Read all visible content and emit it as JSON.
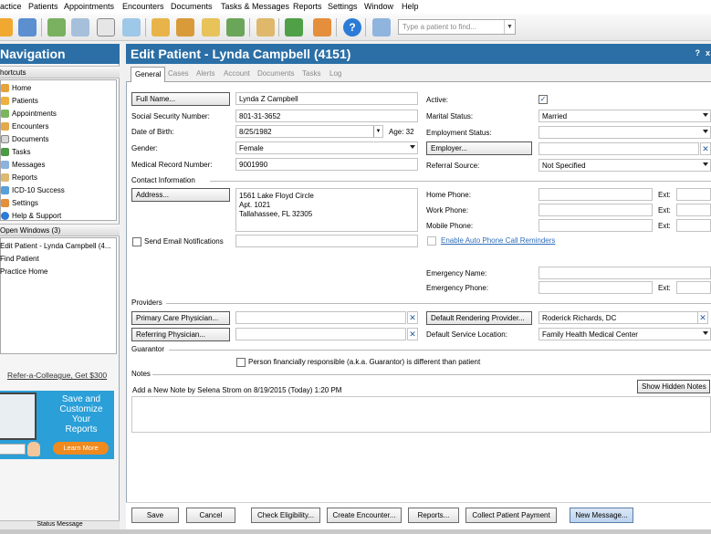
{
  "menu": [
    "actice",
    "Patients",
    "Appointments",
    "Encounters",
    "Documents",
    "Tasks & Messages",
    "Reports",
    "Settings",
    "Window",
    "Help"
  ],
  "toolbar": {
    "find_placeholder": "Type a patient to find..."
  },
  "nav": {
    "title": "Navigation",
    "shortcuts_header": "hortcuts",
    "shortcuts": [
      "Home",
      "Patients",
      "Appointments",
      "Encounters",
      "Documents",
      "Tasks",
      "Messages",
      "Reports",
      "ICD-10 Success",
      "Settings",
      "Help & Support"
    ],
    "open_windows_header": "Open Windows (3)",
    "open_windows": [
      "Edit Patient - Lynda Campbell (4...",
      "Find Patient",
      "Practice Home"
    ],
    "refer_link": "Refer-a-Colleague, Get $300",
    "ad_text": [
      "Save and",
      "Customize",
      "Your",
      "Reports"
    ],
    "ad_button": "Learn More",
    "status_message": "Status Message"
  },
  "window": {
    "title": "Edit Patient - Lynda Campbell (4151)",
    "help": "?",
    "close": "x"
  },
  "tabs": [
    "General",
    "Cases",
    "Alerts",
    "Account",
    "Documents",
    "Tasks",
    "Log"
  ],
  "patient": {
    "full_name_btn": "Full Name...",
    "full_name": "Lynda Z Campbell",
    "ssn_label": "Social Security Number:",
    "ssn": "801-31-3652",
    "dob_label": "Date of Birth:",
    "dob": "8/25/1982",
    "age_label": "Age: 32",
    "gender_label": "Gender:",
    "gender": "Female",
    "mrn_label": "Medical Record Number:",
    "mrn": "9001990",
    "active_label": "Active:",
    "marital_label": "Marital Status:",
    "marital": "Married",
    "employment_label": "Employment Status:",
    "employer_btn": "Employer...",
    "referral_label": "Referral Source:",
    "referral": "Not Specified"
  },
  "contact": {
    "header": "Contact Information",
    "address_btn": "Address...",
    "address_lines": [
      "1561 Lake Floyd Circle",
      "Apt. 1021",
      "Tallahassee, FL 32305"
    ],
    "home_phone_label": "Home Phone:",
    "work_phone_label": "Work Phone:",
    "mobile_phone_label": "Mobile Phone:",
    "ext_label": "Ext:",
    "send_email_label": "Send Email Notifications",
    "auto_phone_link": "Enable Auto Phone Call Reminders",
    "emergency_name_label": "Emergency Name:",
    "emergency_phone_label": "Emergency Phone:"
  },
  "providers": {
    "header": "Providers",
    "pcp_btn": "Primary Care Physician...",
    "ref_btn": "Referring Physician...",
    "rendering_btn": "Default Rendering Provider...",
    "rendering": "Roderick Richards, DC",
    "location_label": "Default Service Location:",
    "location": "Family Health Medical Center"
  },
  "guarantor": {
    "header": "Guarantor",
    "checkbox_label": "Person financially responsible (a.k.a. Guarantor) is different than patient"
  },
  "notes": {
    "header": "Notes",
    "add_note": "Add a New Note by Selena Strom on 8/19/2015 (Today) 1:20 PM",
    "show_hidden": "Show Hidden Notes"
  },
  "footer": {
    "save": "Save",
    "cancel": "Cancel",
    "eligibility": "Check Eligibility...",
    "encounter": "Create Encounter...",
    "reports": "Reports...",
    "payment": "Collect Patient Payment",
    "message": "New Message..."
  }
}
